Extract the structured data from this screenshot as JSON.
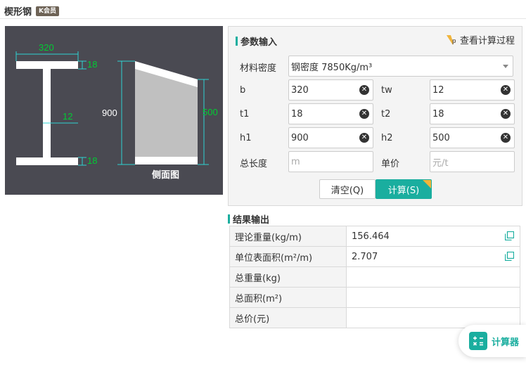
{
  "page": {
    "title": "楔形钢",
    "badge": "K会员"
  },
  "diagram": {
    "b_label": "320",
    "t1_label": "18",
    "tw_label": "12",
    "t2_label": "18",
    "h1_label": "900",
    "h2_label": "500",
    "side_view": "侧面图",
    "dim_color": "#00cc33",
    "line_color": "#2fd3d3"
  },
  "params": {
    "title": "参数输入",
    "calc_process": "查看计算过程",
    "density_label": "材料密度",
    "density_value": "钢密度 7850Kg/m³",
    "b_label": "b",
    "b_value": "320",
    "tw_label": "tw",
    "tw_value": "12",
    "t1_label": "t1",
    "t1_value": "18",
    "t2_label": "t2",
    "t2_value": "18",
    "h1_label": "h1",
    "h1_value": "900",
    "h2_label": "h2",
    "h2_value": "500",
    "length_label": "总长度",
    "length_placeholder": "m",
    "price_label": "单价",
    "price_placeholder": "元/t",
    "clear_button": "清空(Q)",
    "calc_button": "计算(S)"
  },
  "results": {
    "title": "结果输出",
    "rows": [
      {
        "name": "理论重量(kg/m)",
        "value": "156.464"
      },
      {
        "name": "单位表面积(m²/m)",
        "value": "2.707"
      },
      {
        "name": "总重量(kg)",
        "value": ""
      },
      {
        "name": "总面积(m²)",
        "value": ""
      },
      {
        "name": "总价(元)",
        "value": ""
      }
    ]
  },
  "float_button": {
    "label": "计算器"
  },
  "colors": {
    "accent": "#1aae9f",
    "vip": "#f0b43a"
  }
}
